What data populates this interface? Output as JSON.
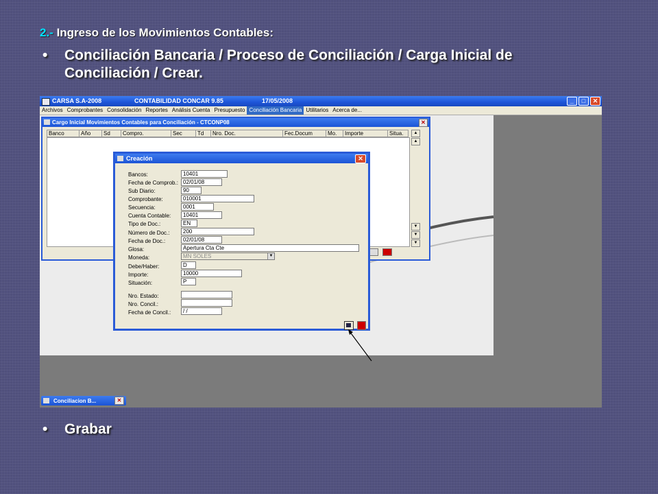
{
  "slide": {
    "heading_num": "2.-",
    "heading_text": " Ingreso de los Movimientos Contables:",
    "bullet1": "Conciliación Bancaria / Proceso de Conciliación / Carga Inicial de Conciliación / Crear.",
    "bullet2": "Grabar",
    "bullet_char": "•"
  },
  "app": {
    "title_company": "CARSA S.A-2008",
    "title_system": "CONTABILIDAD CONCAR 9.85",
    "title_date": "17/05/2008",
    "menu": [
      "Archivos",
      "Comprobantes",
      "Consolidación",
      "Reportes",
      "Análisis Cuenta",
      "Presupuesto",
      "Conciliación Bancaria",
      "Utilitarios",
      "Acerca de..."
    ],
    "active_menu": "Conciliación Bancaria",
    "minimize": "_",
    "maximize": "□",
    "close": "✕"
  },
  "grid_window": {
    "title": "Cargo Inicial Movimientos Contables para Conciliación - CTCONP08",
    "close": "✕",
    "columns": [
      "Banco",
      "Año",
      "Sd",
      "Compro.",
      "Sec",
      "Td",
      "Nro. Doc.",
      "Fec.Docum",
      "Mo.",
      "Importe",
      "Situa."
    ]
  },
  "dialog": {
    "title": "Creación",
    "close": "✕",
    "fields": [
      {
        "label": "Bancos:",
        "value": "10401"
      },
      {
        "label": "Fecha de Comprob.:",
        "value": "02/01/08"
      },
      {
        "label": "Sub Diario:",
        "value": "90"
      },
      {
        "label": "Comprobante:",
        "value": "010001"
      },
      {
        "label": "Secuencia:",
        "value": "0001"
      },
      {
        "label": "Cuenta Contable:",
        "value": "10401"
      },
      {
        "label": "Tipo de Doc.:",
        "value": "EN"
      },
      {
        "label": "Número de Doc.:",
        "value": "200"
      },
      {
        "label": "Fecha de Doc.:",
        "value": "02/01/08"
      },
      {
        "label": "Glosa:",
        "value": "Apertura Cta Cte"
      },
      {
        "label": "Moneda:",
        "value": "MN      SOLES"
      },
      {
        "label": "Debe/Haber:",
        "value": "D"
      },
      {
        "label": "Importe:",
        "value": "10000"
      },
      {
        "label": "Situación:",
        "value": "P"
      },
      {
        "label": "Nro. Estado:",
        "value": ""
      },
      {
        "label": "Nro. Concil.:",
        "value": ""
      },
      {
        "label": "Fecha de Concil.:",
        "value": " /  /"
      }
    ]
  },
  "taskbar": {
    "item": "Conciliacion B...",
    "close": "✕"
  },
  "colors": {
    "slide_bg": "#52527f",
    "heading_accent": "#00e0ff",
    "xp_blue": "#1d55d8",
    "xp_close": "#d84a2a"
  }
}
